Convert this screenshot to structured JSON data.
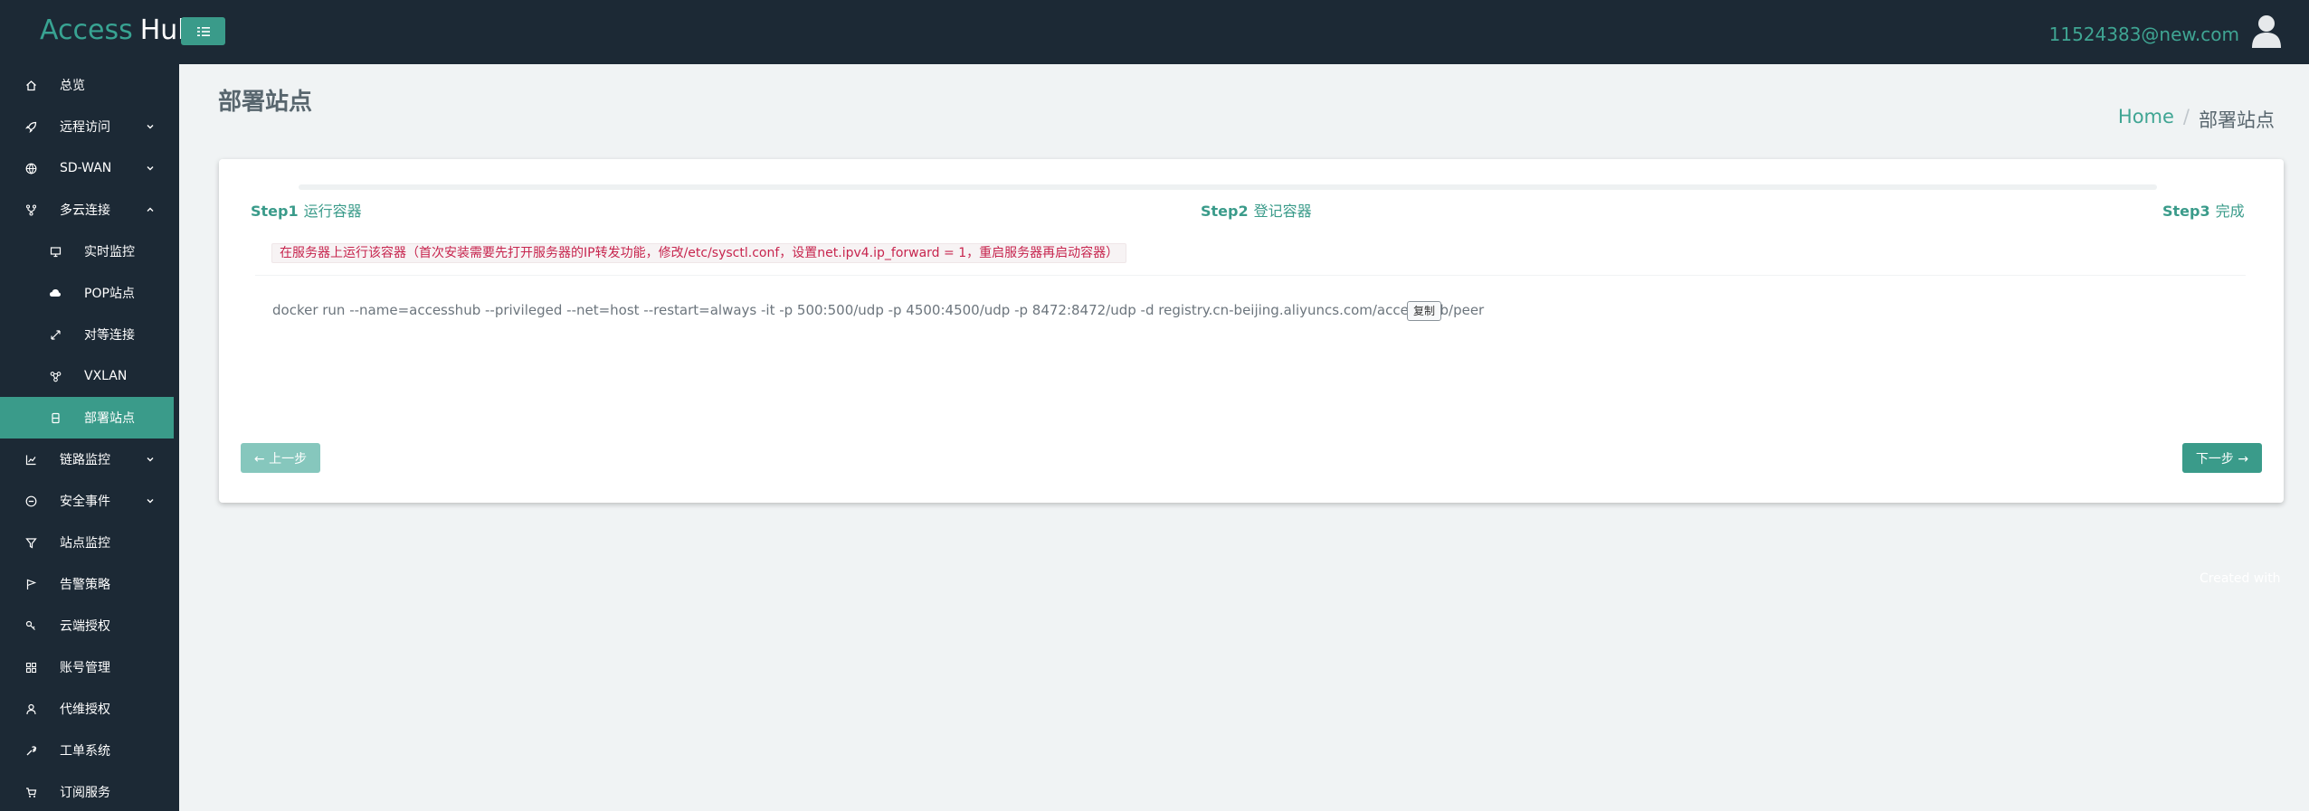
{
  "header": {
    "brand_part1": "Access",
    "brand_part2": "Hub",
    "user_email": "11524383@new.com"
  },
  "sidebar": {
    "items": [
      {
        "label": "总览",
        "icon": "home-icon"
      },
      {
        "label": "远程访问",
        "icon": "rocket-icon",
        "chevron": "down"
      },
      {
        "label": "SD-WAN",
        "icon": "globe-icon",
        "chevron": "down"
      },
      {
        "label": "多云连接",
        "icon": "fork-icon",
        "chevron": "up"
      },
      {
        "label": "实时监控",
        "icon": "monitor-icon",
        "sub": true
      },
      {
        "label": "POP站点",
        "icon": "cloud-icon",
        "sub": true
      },
      {
        "label": "对等连接",
        "icon": "expand-icon",
        "sub": true
      },
      {
        "label": "VXLAN",
        "icon": "network-icon",
        "sub": true
      },
      {
        "label": "部署站点",
        "icon": "server-icon",
        "sub": true,
        "active": true
      },
      {
        "label": "链路监控",
        "icon": "chart-line-icon",
        "chevron": "down"
      },
      {
        "label": "安全事件",
        "icon": "minus-circle-icon",
        "chevron": "down"
      },
      {
        "label": "站点监控",
        "icon": "filter-icon"
      },
      {
        "label": "告警策略",
        "icon": "flag-icon"
      },
      {
        "label": "云端授权",
        "icon": "link-icon"
      },
      {
        "label": "账号管理",
        "icon": "grid-icon"
      },
      {
        "label": "代维授权",
        "icon": "user-icon"
      },
      {
        "label": "工单系统",
        "icon": "wrench-icon"
      },
      {
        "label": "订阅服务",
        "icon": "cart-icon"
      }
    ]
  },
  "page": {
    "title": "部署站点",
    "breadcrumb_home": "Home",
    "breadcrumb_sep": "/",
    "breadcrumb_current": "部署站点"
  },
  "wizard": {
    "steps": [
      {
        "num": "Step1",
        "name": "运行容器"
      },
      {
        "num": "Step2",
        "name": "登记容器"
      },
      {
        "num": "Step3",
        "name": "完成"
      }
    ],
    "alert": "在服务器上运行该容器（首次安装需要先打开服务器的IP转发功能，修改/etc/sysctl.conf，设置net.ipv4.ip_forward = 1，重启服务器再启动容器）",
    "command": "docker run --name=accesshub --privileged --net=host --restart=always -it -p 500:500/udp -p 4500:4500/udp -p 8472:8472/udp -d registry.cn-beijing.aliyuncs.com/accesshub/peer",
    "copy_label": "复制",
    "prev_label": "← 上一步",
    "next_label": "下一步 →"
  },
  "footer": {
    "text": "Created with"
  },
  "colors": {
    "sidebar_bg": "#1c2935",
    "accent": "#3a9b8a",
    "page_bg": "#f0f3f4",
    "alert_text": "#c7254e"
  }
}
